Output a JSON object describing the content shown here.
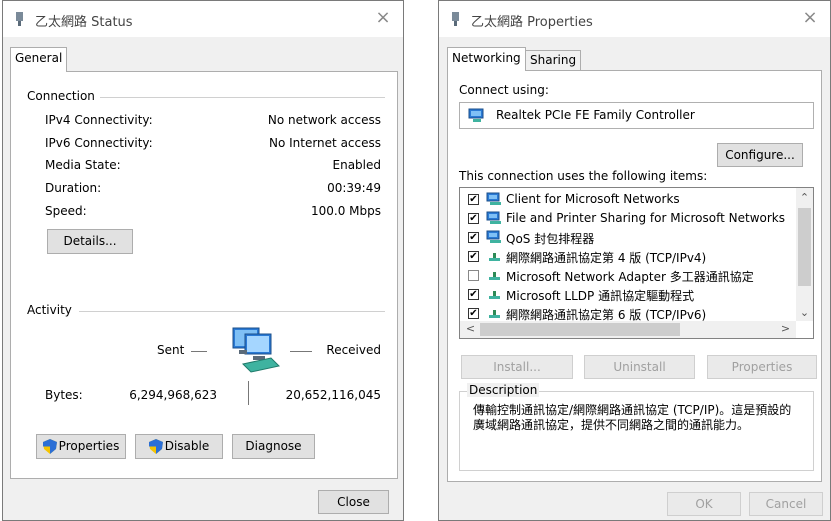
{
  "status_window": {
    "title": "乙太網路 Status",
    "close_glyph": "×",
    "tab_general": "General",
    "connection_header": "Connection",
    "rows": [
      {
        "label": "IPv4 Connectivity:",
        "value": "No network access"
      },
      {
        "label": "IPv6 Connectivity:",
        "value": "No Internet access"
      },
      {
        "label": "Media State:",
        "value": "Enabled"
      },
      {
        "label": "Duration:",
        "value": "00:39:49"
      },
      {
        "label": "Speed:",
        "value": "100.0 Mbps"
      }
    ],
    "details_button": "Details...",
    "activity_header": "Activity",
    "sent_label": "Sent",
    "received_label": "Received",
    "bytes_label": "Bytes:",
    "bytes_sent": "6,294,968,623",
    "bytes_received": "20,652,116,045",
    "properties_button": "Properties",
    "disable_button": "Disable",
    "diagnose_button": "Diagnose",
    "close_button": "Close"
  },
  "props_window": {
    "title": "乙太網路 Properties",
    "close_glyph": "×",
    "tab_networking": "Networking",
    "tab_sharing": "Sharing",
    "connect_using_label": "Connect using:",
    "adapter_name": "Realtek PCIe FE Family Controller",
    "configure_button": "Configure...",
    "items_label": "This connection uses the following items:",
    "items": [
      {
        "checked": true,
        "icon": "network-client-icon",
        "text": "Client for Microsoft Networks"
      },
      {
        "checked": true,
        "icon": "network-client-icon",
        "text": "File and Printer Sharing for Microsoft Networks"
      },
      {
        "checked": true,
        "icon": "network-client-icon",
        "text": "QoS 封包排程器"
      },
      {
        "checked": true,
        "icon": "protocol-icon",
        "text": "網際網路通訊協定第 4 版 (TCP/IPv4)"
      },
      {
        "checked": false,
        "icon": "protocol-icon",
        "text": "Microsoft Network Adapter 多工器通訊協定"
      },
      {
        "checked": true,
        "icon": "protocol-icon",
        "text": "Microsoft LLDP 通訊協定驅動程式"
      },
      {
        "checked": true,
        "icon": "protocol-icon",
        "text": "網際網路通訊協定第 6 版 (TCP/IPv6)"
      }
    ],
    "install_button": "Install...",
    "uninstall_button": "Uninstall",
    "properties_button": "Properties",
    "description_title": "Description",
    "description_text": "傳輸控制通訊協定/網際網路通訊協定 (TCP/IP)。這是預設的廣域網路通訊協定，提供不同網路之間的通訊能力。",
    "ok_button": "OK",
    "cancel_button": "Cancel"
  },
  "colors": {
    "accent_blue": "#2a7ad5",
    "shield_yellow": "#f5c400",
    "shield_blue": "#2b6fd6"
  }
}
